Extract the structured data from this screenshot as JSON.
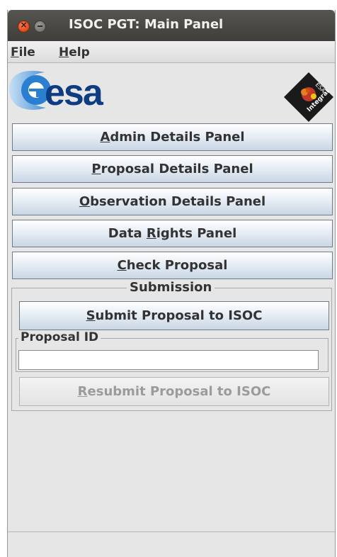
{
  "window": {
    "title": "ISOC PGT: Main Panel"
  },
  "menubar": {
    "file": {
      "mnemonic": "F",
      "rest": "ile"
    },
    "help": {
      "mnemonic": "H",
      "rest": "elp"
    }
  },
  "logos": {
    "esa_text": "esa",
    "integral_text": "Integral"
  },
  "buttons": {
    "admin": {
      "pre": "",
      "mnemonic": "A",
      "post": "dmin Details Panel"
    },
    "proposal": {
      "pre": "",
      "mnemonic": "P",
      "post": "roposal Details Panel"
    },
    "observation": {
      "pre": "",
      "mnemonic": "O",
      "post": "bservation Details Panel"
    },
    "data_rights": {
      "pre": "Data ",
      "mnemonic": "R",
      "post": "ights Panel"
    },
    "check": {
      "pre": "",
      "mnemonic": "C",
      "post": "heck Proposal"
    }
  },
  "submission": {
    "legend": "Submission",
    "submit": {
      "pre": "",
      "mnemonic": "S",
      "post": "ubmit Proposal to ISOC"
    },
    "proposal_id_label": "Proposal ID",
    "proposal_id_value": "",
    "resubmit": {
      "pre": "",
      "mnemonic": "R",
      "post": "esubmit Proposal to ISOC",
      "enabled": false
    }
  },
  "status_bar": {
    "text": ""
  }
}
